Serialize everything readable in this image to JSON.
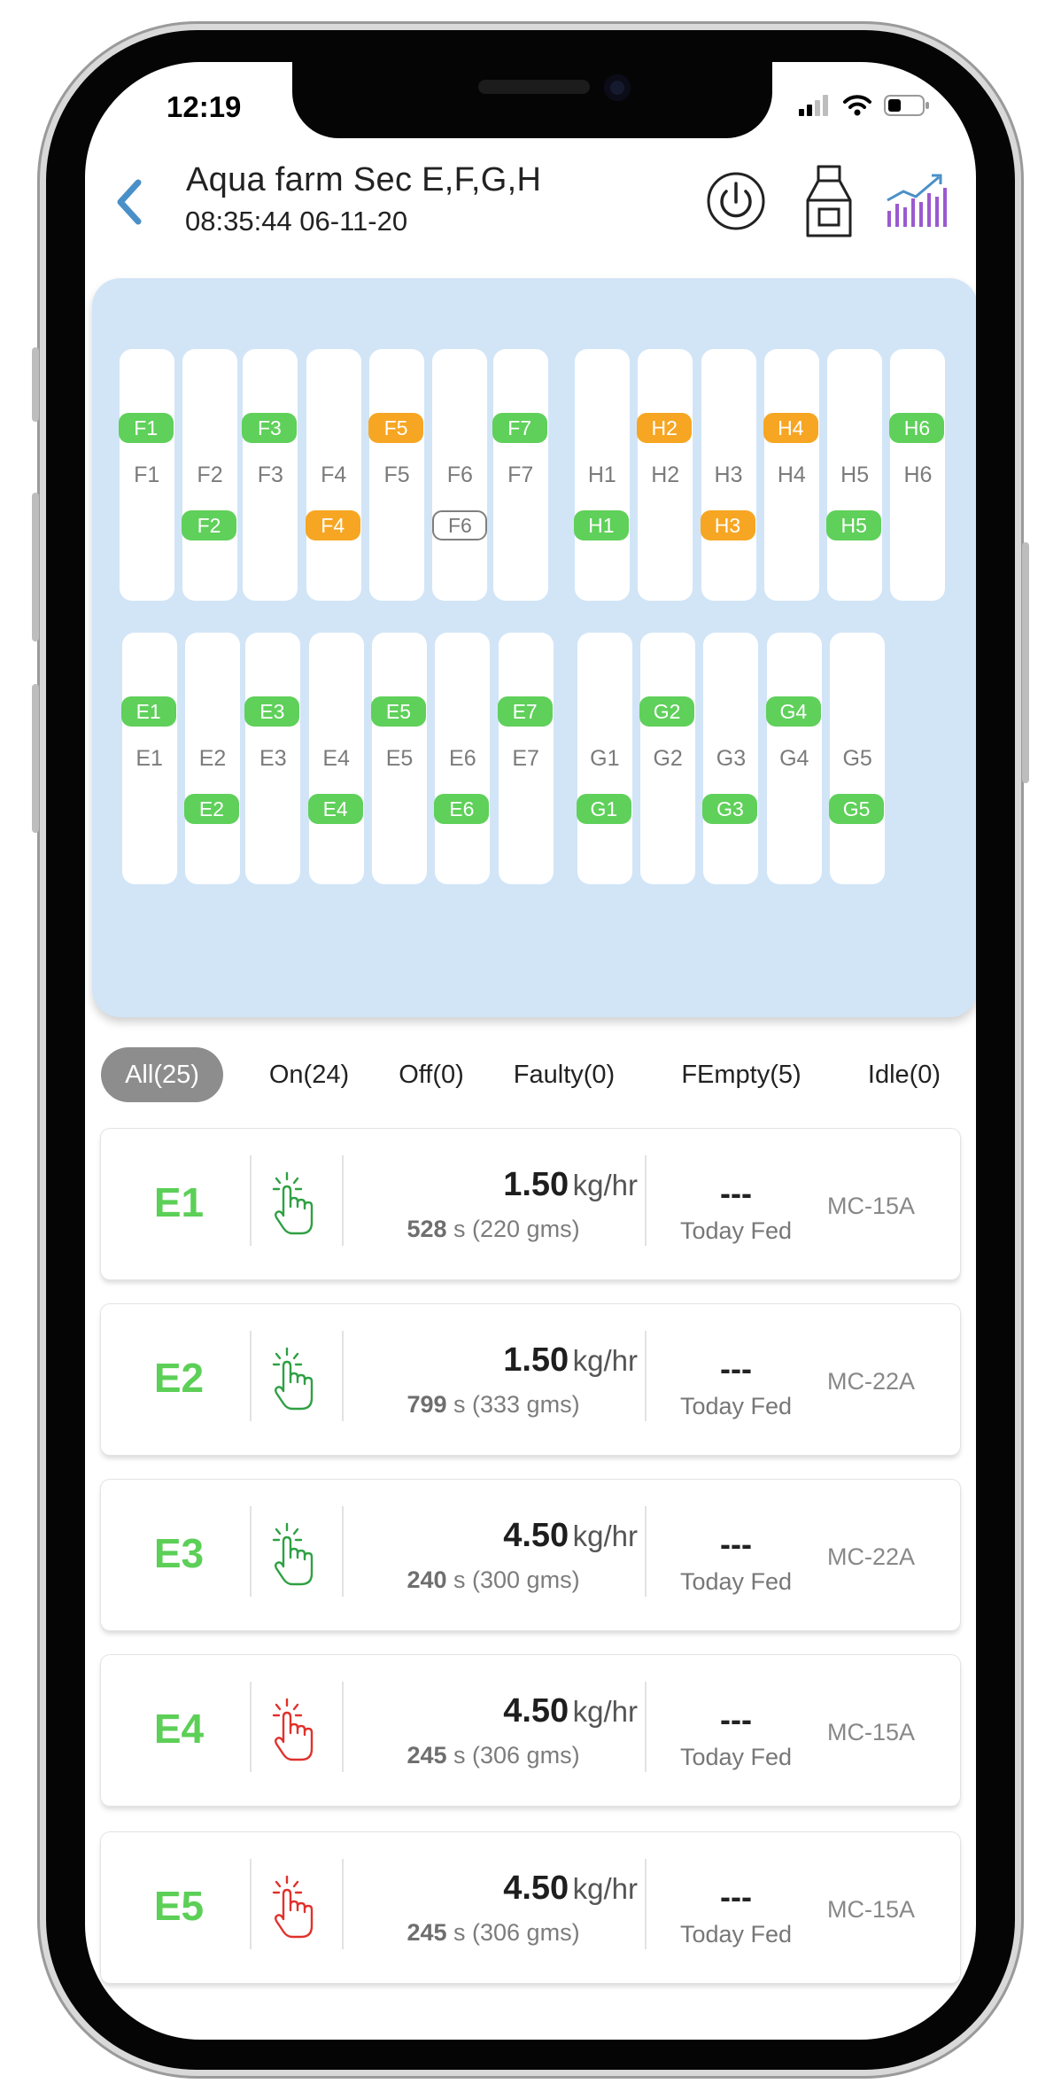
{
  "status": {
    "time": "12:19"
  },
  "header": {
    "title": "Aqua farm Sec  E,F,G,H",
    "subtitle": "08:35:44 06-11-20"
  },
  "colors": {
    "on": "#5fd05a",
    "warning": "#f6a623",
    "accent": "#4a90c8",
    "chart": "#9b59d0"
  },
  "pond": {
    "rows": [
      {
        "lanes": [
          {
            "label": "F1",
            "chip": "F1",
            "state": "on",
            "pos": "top"
          },
          {
            "label": "F2",
            "chip": "F2",
            "state": "on",
            "pos": "bottom"
          },
          {
            "label": "F3",
            "chip": "F3",
            "state": "on",
            "pos": "top"
          },
          {
            "label": "F4",
            "chip": "F4",
            "state": "warn",
            "pos": "bottom"
          },
          {
            "label": "F5",
            "chip": "F5",
            "state": "warn",
            "pos": "top"
          },
          {
            "label": "F6",
            "chip": "F6",
            "state": "off",
            "pos": "bottom"
          },
          {
            "label": "F7",
            "chip": "F7",
            "state": "on",
            "pos": "top"
          },
          {
            "label": "H1",
            "chip": "H1",
            "state": "on",
            "pos": "bottom"
          },
          {
            "label": "H2",
            "chip": "H2",
            "state": "warn",
            "pos": "top"
          },
          {
            "label": "H3",
            "chip": "H3",
            "state": "warn",
            "pos": "bottom"
          },
          {
            "label": "H4",
            "chip": "H4",
            "state": "warn",
            "pos": "top"
          },
          {
            "label": "H5",
            "chip": "H5",
            "state": "on",
            "pos": "bottom"
          },
          {
            "label": "H6",
            "chip": "H6",
            "state": "on",
            "pos": "top"
          }
        ]
      },
      {
        "lanes": [
          {
            "label": "E1",
            "chip": "E1",
            "state": "on",
            "pos": "top"
          },
          {
            "label": "E2",
            "chip": "E2",
            "state": "on",
            "pos": "bottom"
          },
          {
            "label": "E3",
            "chip": "E3",
            "state": "on",
            "pos": "top"
          },
          {
            "label": "E4",
            "chip": "E4",
            "state": "on",
            "pos": "bottom"
          },
          {
            "label": "E5",
            "chip": "E5",
            "state": "on",
            "pos": "top"
          },
          {
            "label": "E6",
            "chip": "E6",
            "state": "on",
            "pos": "bottom"
          },
          {
            "label": "E7",
            "chip": "E7",
            "state": "on",
            "pos": "top"
          },
          {
            "label": "G1",
            "chip": "G1",
            "state": "on",
            "pos": "bottom"
          },
          {
            "label": "G2",
            "chip": "G2",
            "state": "on",
            "pos": "top"
          },
          {
            "label": "G3",
            "chip": "G3",
            "state": "on",
            "pos": "bottom"
          },
          {
            "label": "G4",
            "chip": "G4",
            "state": "on",
            "pos": "top"
          },
          {
            "label": "G5",
            "chip": "G5",
            "state": "on",
            "pos": "bottom"
          }
        ]
      }
    ]
  },
  "tabs": [
    {
      "label": "All(25)",
      "active": true
    },
    {
      "label": "On(24)"
    },
    {
      "label": "Off(0)"
    },
    {
      "label": "Faulty(0)"
    },
    {
      "label": "FEmpty(5)"
    },
    {
      "label": "Idle(0)"
    }
  ],
  "feeders": [
    {
      "name": "E1",
      "tap_icon": "tap-green",
      "rate": "1.50",
      "unit": "kg/hr",
      "secs": "528",
      "detail": "s (220 gms)",
      "fed": "---",
      "fed_label": "Today Fed",
      "model": "MC-15A"
    },
    {
      "name": "E2",
      "tap_icon": "tap-green",
      "rate": "1.50",
      "unit": "kg/hr",
      "secs": "799",
      "detail": "s (333 gms)",
      "fed": "---",
      "fed_label": "Today Fed",
      "model": "MC-22A"
    },
    {
      "name": "E3",
      "tap_icon": "tap-green",
      "rate": "4.50",
      "unit": "kg/hr",
      "secs": "240",
      "detail": "s (300 gms)",
      "fed": "---",
      "fed_label": "Today Fed",
      "model": "MC-22A"
    },
    {
      "name": "E4",
      "tap_icon": "tap-red",
      "rate": "4.50",
      "unit": "kg/hr",
      "secs": "245",
      "detail": "s (306 gms)",
      "fed": "---",
      "fed_label": "Today Fed",
      "model": "MC-15A"
    },
    {
      "name": "E5",
      "tap_icon": "tap-red",
      "rate": "4.50",
      "unit": "kg/hr",
      "secs": "245",
      "detail": "s (306 gms)",
      "fed": "---",
      "fed_label": "Today Fed",
      "model": "MC-15A"
    }
  ]
}
